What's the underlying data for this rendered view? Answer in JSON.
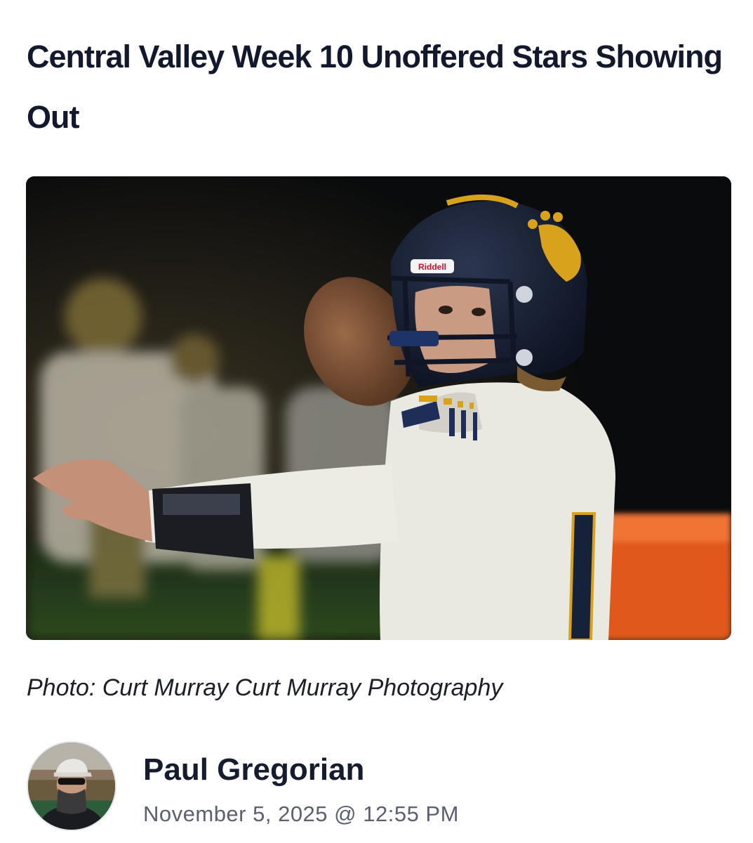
{
  "article": {
    "title": "Central Valley Week 10 Unoffered Stars Showing Out",
    "photo_caption": "Photo: Curt Murray Curt Murray Photography",
    "hero_image_icon": "football-quarterback-photo",
    "helmet_brand": "Riddell"
  },
  "author": {
    "name": "Paul Gregorian",
    "date": "November 5, 2025 @ 12:55 PM",
    "avatar_icon": "author-avatar"
  },
  "colors": {
    "title": "#12192c",
    "caption": "#1c1f27",
    "date": "#5b6070",
    "team_navy": "#16213a",
    "team_gold": "#d9a21c"
  }
}
